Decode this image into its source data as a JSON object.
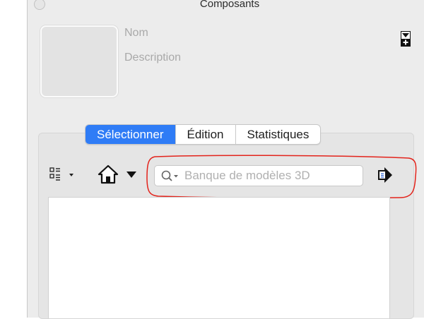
{
  "window": {
    "title": "Composants"
  },
  "component": {
    "name_placeholder": "Nom",
    "description_placeholder": "Description"
  },
  "tabs": [
    {
      "label": "Sélectionner",
      "active": true
    },
    {
      "label": "Édition",
      "active": false
    },
    {
      "label": "Statistiques",
      "active": false
    }
  ],
  "toolbar": {
    "view_options_icon": "list-grid-icon",
    "home_icon": "home-icon",
    "go_icon": "arrow-right-icon"
  },
  "search": {
    "placeholder": "Banque de modèles 3D",
    "value": ""
  },
  "colors": {
    "accent": "#2f7cf6",
    "annotation": "#e3231b",
    "panel": "#ececec"
  }
}
